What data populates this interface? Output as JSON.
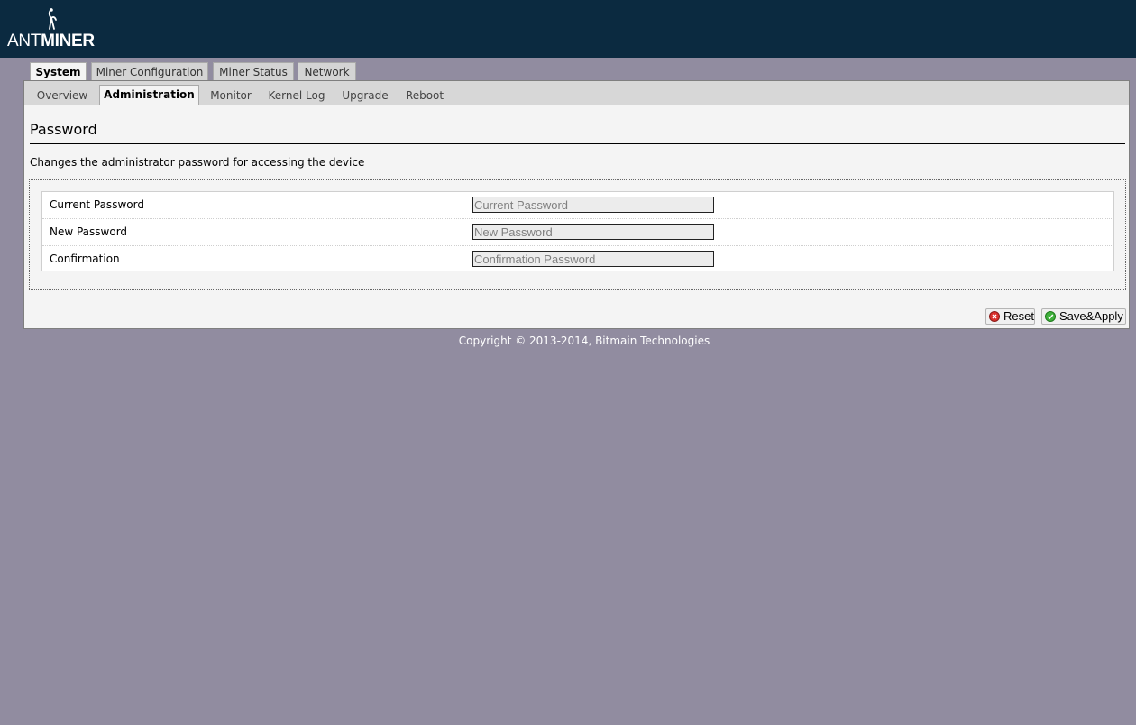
{
  "brand": {
    "logo_text_light": "ANT",
    "logo_text_bold": "MINER",
    "header_color": "#0b2a40"
  },
  "main_tabs": [
    {
      "label": "System",
      "active": true
    },
    {
      "label": "Miner Configuration",
      "active": false
    },
    {
      "label": "Miner Status",
      "active": false
    },
    {
      "label": "Network",
      "active": false
    }
  ],
  "sub_tabs": [
    {
      "label": "Overview",
      "active": false
    },
    {
      "label": "Administration",
      "active": true
    },
    {
      "label": "Monitor",
      "active": false
    },
    {
      "label": "Kernel Log",
      "active": false
    },
    {
      "label": "Upgrade",
      "active": false
    },
    {
      "label": "Reboot",
      "active": false
    }
  ],
  "page": {
    "title": "Password",
    "description": "Changes the administrator password for accessing the device"
  },
  "form": {
    "fields": [
      {
        "label": "Current Password",
        "placeholder": "Current Password",
        "value": ""
      },
      {
        "label": "New Password",
        "placeholder": "New Password",
        "value": ""
      },
      {
        "label": "Confirmation",
        "placeholder": "Confirmation Password",
        "value": ""
      }
    ]
  },
  "actions": {
    "reset_label": "Reset",
    "reset_icon": "red-x-circle-icon",
    "save_label": "Save&Apply",
    "save_icon": "green-check-circle-icon"
  },
  "footer": {
    "copyright": "Copyright © 2013-2014, Bitmain Technologies"
  }
}
